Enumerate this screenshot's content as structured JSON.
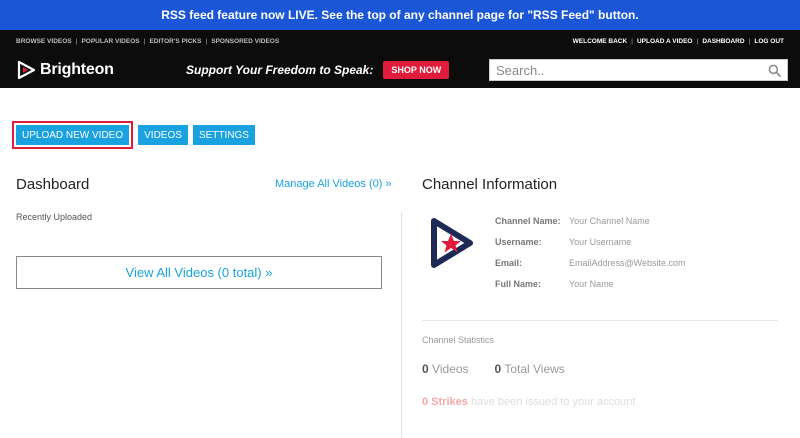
{
  "banner": {
    "text": "RSS feed feature now LIVE. See the top of any channel page for \"RSS Feed\" button."
  },
  "topnav": {
    "left": [
      "BROWSE VIDEOS",
      "POPULAR VIDEOS",
      "EDITOR'S PICKS",
      "SPONSORED VIDEOS"
    ],
    "right": [
      "WELCOME BACK",
      "UPLOAD A VIDEO",
      "DASHBOARD",
      "LOG OUT"
    ],
    "separator": "|"
  },
  "header": {
    "logo_text": "Brighteon",
    "promo_text": "Support Your Freedom to Speak:",
    "shop_button": "SHOP NOW",
    "search_placeholder": "Search.."
  },
  "tabs": {
    "upload": "UPLOAD NEW VIDEO",
    "videos": "VIDEOS",
    "settings": "SETTINGS"
  },
  "dashboard": {
    "title": "Dashboard",
    "manage_link": "Manage All Videos (0) »",
    "recent_label": "Recently Uploaded",
    "view_all": "View All Videos (0 total) »"
  },
  "channel": {
    "title": "Channel Information",
    "fields": [
      {
        "label": "Channel Name:",
        "value": "Your Channel Name"
      },
      {
        "label": "Username:",
        "value": "Your Username"
      },
      {
        "label": "Email:",
        "value": "EmailAddress@Website.com"
      },
      {
        "label": "Full Name:",
        "value": "Your Name"
      }
    ]
  },
  "stats": {
    "label": "Channel Statistics",
    "videos_count": "0",
    "videos_label": "Videos",
    "views_count": "0",
    "views_label": "Total Views",
    "strikes_count": "0 Strikes",
    "strikes_text": "have been issued to your account"
  },
  "colors": {
    "accent": "#1aa2e0",
    "brand_red": "#e01b3c",
    "banner": "#1a56d6",
    "logo_navy": "#1e2a55"
  },
  "icons": {
    "search": "search-icon",
    "logo": "brighteon-logo-icon"
  }
}
